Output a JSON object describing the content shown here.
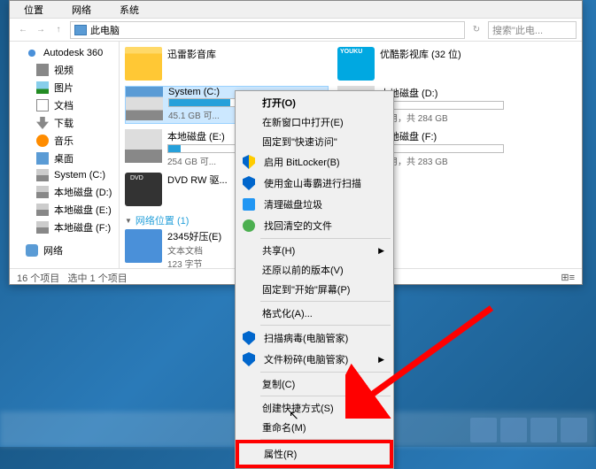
{
  "tabs": {
    "t1": "位置",
    "t2": "网络",
    "t3": "系统"
  },
  "addr": {
    "location": "此电脑",
    "search_ph": "搜索\"此电...",
    "refresh": "↻"
  },
  "sidebar": {
    "autodesk": "Autodesk 360",
    "video": "视频",
    "pics": "图片",
    "docs": "文档",
    "dl": "下载",
    "music": "音乐",
    "desktop": "桌面",
    "sysc": "System (C:)",
    "diskd": "本地磁盘 (D:)",
    "diske": "本地磁盘 (E:)",
    "diskf": "本地磁盘 (F:)",
    "network": "网络"
  },
  "content": {
    "xunlei": {
      "title": "迅雷影音库"
    },
    "youku": {
      "title": "优酷影视库 (32 位)"
    },
    "sysc": {
      "title": "System (C:)",
      "sub": "45.1 GB 可..."
    },
    "diskd": {
      "title": "本地磁盘 (D:)",
      "sub": "可用，共 284 GB"
    },
    "diske": {
      "title": "本地磁盘 (E:)",
      "sub": "254 GB 可..."
    },
    "diskf": {
      "title": "本地磁盘 (F:)",
      "sub": "可用，共 283 GB"
    },
    "dvd": {
      "title": "DVD RW 驱..."
    },
    "netloc_hdr": "网络位置 (1)",
    "zip": {
      "title": "2345好压(E)",
      "sub1": "文本文档",
      "sub2": "123 字节"
    }
  },
  "status": {
    "count": "16 个项目",
    "sel": "选中 1 个项目",
    "view": "⊞≡"
  },
  "ctx": {
    "open": "打开(O)",
    "newwin": "在新窗口中打开(E)",
    "pinquick": "固定到\"快速访问\"",
    "bitlocker": "启用 BitLocker(B)",
    "jinshan": "使用金山毒霸进行扫描",
    "trash": "清理磁盘垃圾",
    "findempty": "找回清空的文件",
    "share": "共享(H)",
    "restore": "还原以前的版本(V)",
    "pinstart": "固定到\"开始\"屏幕(P)",
    "format": "格式化(A)...",
    "virus": "扫描病毒(电脑管家)",
    "shred": "文件粉碎(电脑管家)",
    "copy": "复制(C)",
    "shortcut": "创建快捷方式(S)",
    "rename": "重命名(M)",
    "props": "属性(R)"
  }
}
